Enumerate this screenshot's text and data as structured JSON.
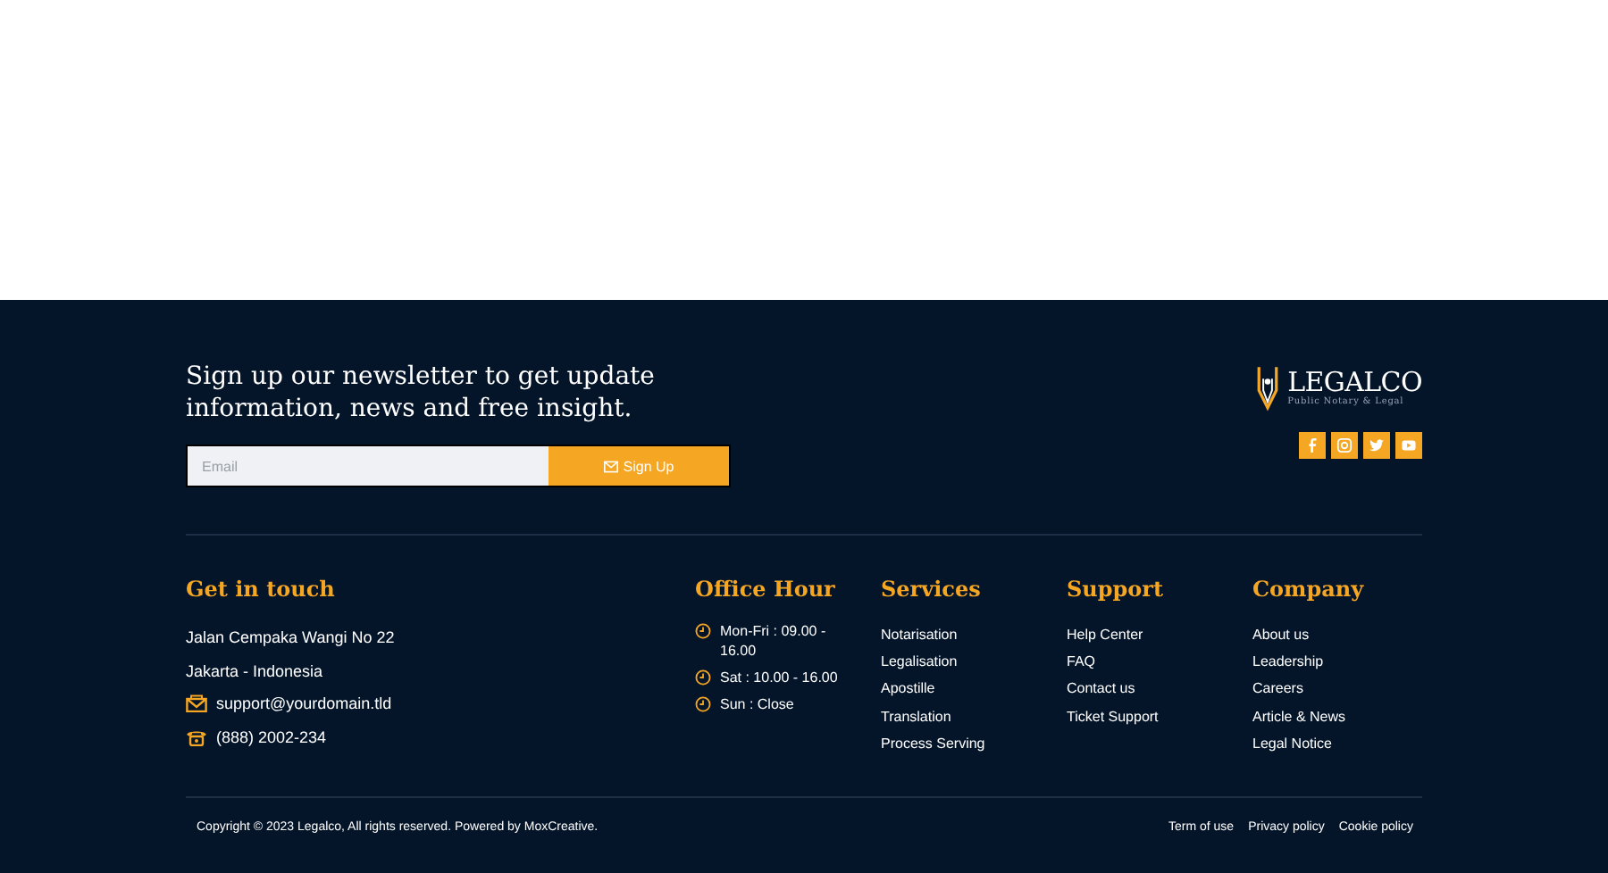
{
  "newsletter": {
    "heading": "Sign up our newsletter to get update information, news and free insight.",
    "email": {
      "placeholder": "Email"
    },
    "button": "Sign Up"
  },
  "brand": {
    "name": "LEGALCO",
    "tagline": "Public Notary & Legal",
    "social": [
      {
        "kind": "facebook"
      },
      {
        "kind": "instagram"
      },
      {
        "kind": "twitter"
      },
      {
        "kind": "youtube"
      }
    ]
  },
  "contact": {
    "title": "Get in touch",
    "lines": [
      {
        "kind": "text",
        "text": "Jalan Cempaka Wangi No 22"
      },
      {
        "kind": "text",
        "text": "Jakarta - Indonesia"
      },
      {
        "kind": "email",
        "text": "support@yourdomain.tld"
      },
      {
        "kind": "phone",
        "text": "(888) 2002-234"
      }
    ]
  },
  "office_hours": {
    "title": "Office Hour",
    "items": [
      "Mon-Fri : 09.00 - 16.00",
      "Sat : 10.00 - 16.00",
      "Sun : Close"
    ]
  },
  "link_columns": [
    {
      "title": "Services",
      "links": [
        "Notarisation",
        "Legalisation",
        "Apostille",
        "Translation",
        "Process Serving"
      ]
    },
    {
      "title": "Support",
      "links": [
        "Help Center",
        "FAQ",
        "Contact us",
        "Ticket Support"
      ]
    },
    {
      "title": "Company",
      "links": [
        "About us",
        "Leadership",
        "Careers",
        "Article & News",
        "Legal Notice"
      ]
    }
  ],
  "bottom": {
    "copyright": "Copyright © 2023 Legalco, All rights reserved. Powered by MoxCreative.",
    "links": [
      "Term of use",
      "Privacy policy",
      "Cookie policy"
    ]
  }
}
